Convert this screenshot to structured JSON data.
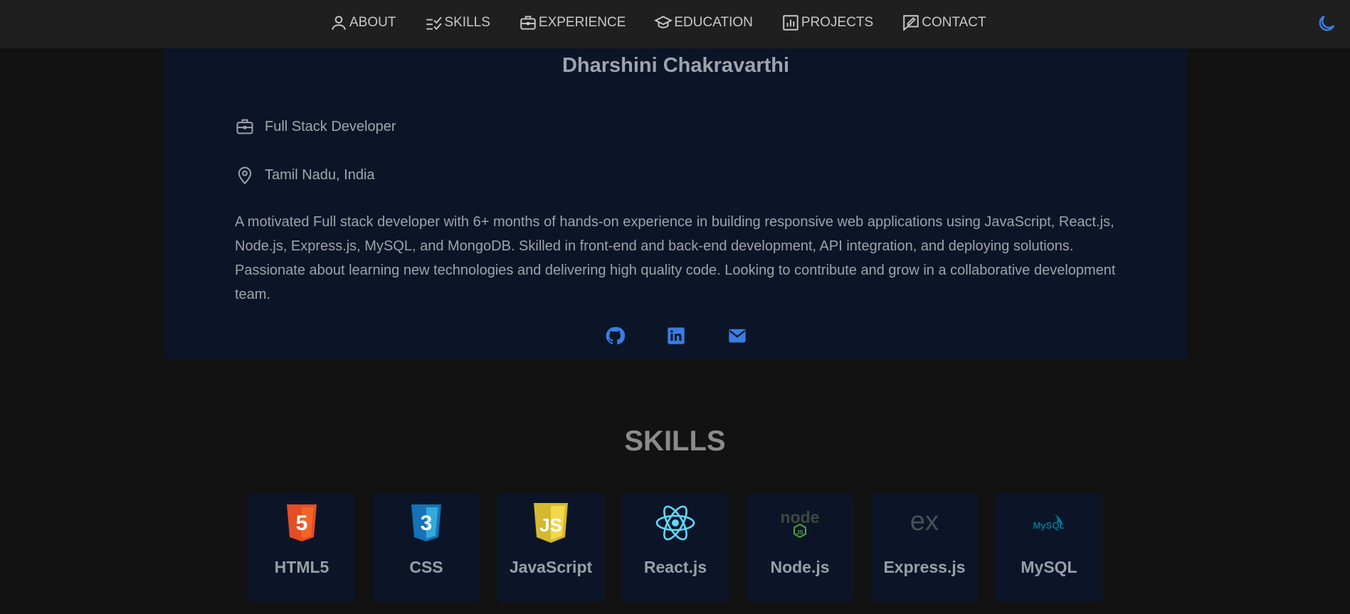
{
  "nav": {
    "items": [
      {
        "label": "ABOUT",
        "icon": "user-icon"
      },
      {
        "label": "SKILLS",
        "icon": "checklist-icon"
      },
      {
        "label": "EXPERIENCE",
        "icon": "briefcase-icon"
      },
      {
        "label": "EDUCATION",
        "icon": "graduation-cap-icon"
      },
      {
        "label": "PROJECTS",
        "icon": "bar-chart-icon"
      },
      {
        "label": "CONTACT",
        "icon": "edit-message-icon"
      }
    ],
    "theme_icon": "moon-icon"
  },
  "profile": {
    "name": "Dharshini Chakravarthi",
    "role": "Full Stack Developer",
    "location": "Tamil Nadu, India",
    "bio": "A motivated Full stack developer with 6+ months of hands-on experience in building responsive web applications using JavaScript, React.js, Node.js, Express.js, MySQL, and MongoDB. Skilled in front-end and back-end development, API integration, and deploying solutions. Passionate about learning new technologies and delivering high quality code. Looking to contribute and grow in a collaborative development team.",
    "socials": [
      "github-icon",
      "linkedin-icon",
      "mail-icon"
    ]
  },
  "skills": {
    "title": "SKILLS",
    "items": [
      {
        "name": "HTML5",
        "icon": "html5-logo",
        "logo_text": "5"
      },
      {
        "name": "CSS",
        "icon": "css3-logo",
        "logo_text": "3"
      },
      {
        "name": "JavaScript",
        "icon": "javascript-logo",
        "logo_text": "JS"
      },
      {
        "name": "React.js",
        "icon": "react-logo"
      },
      {
        "name": "Node.js",
        "icon": "nodejs-logo",
        "logo_text": "node"
      },
      {
        "name": "Express.js",
        "icon": "express-logo",
        "logo_text": "ex"
      },
      {
        "name": "MySQL",
        "icon": "mysql-logo",
        "logo_text": "MySQL"
      }
    ]
  },
  "colors": {
    "nav_bg": "#1f1f1f",
    "page_bg": "#121212",
    "card_bg": "#0c1528",
    "accent": "#3b7de0"
  }
}
